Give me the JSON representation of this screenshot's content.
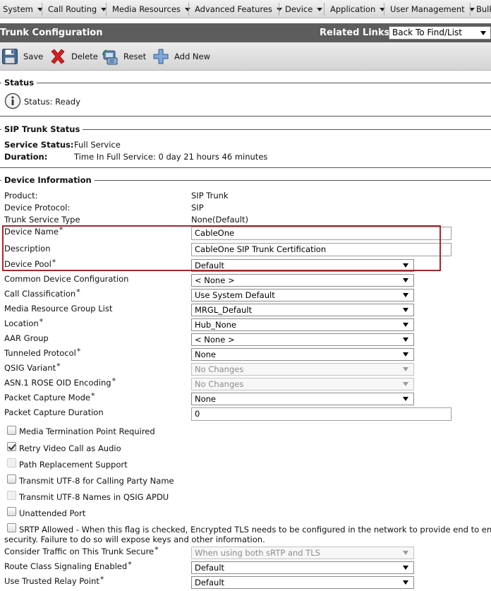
{
  "menu": {
    "items": [
      "System",
      "Call Routing",
      "Media Resources",
      "Advanced Features",
      "Device",
      "Application",
      "User Management",
      "Bulk"
    ]
  },
  "header": {
    "title": "Trunk Configuration",
    "related_links_label": "Related Links:",
    "related_links_value": "Back To Find/List"
  },
  "toolbar": {
    "save": "Save",
    "delete": "Delete",
    "reset": "Reset",
    "add_new": "Add New"
  },
  "status": {
    "section": "Status",
    "text": "Status: Ready"
  },
  "sip_status": {
    "section": "SIP Trunk Status",
    "service_status_label": "Service Status:",
    "service_status_value": "Full Service",
    "duration_label": "Duration:",
    "duration_value": "Time In Full Service: 0 day 21 hours 46 minutes"
  },
  "device_info": {
    "section": "Device Information",
    "product_label": "Product:",
    "product_value": "SIP Trunk",
    "protocol_label": "Device Protocol:",
    "protocol_value": "SIP",
    "service_type_label": "Trunk Service Type",
    "service_type_value": "None(Default)",
    "device_name_label": "Device Name",
    "device_name_value": "CableOne",
    "description_label": "Description",
    "description_value": "CableOne SIP Trunk Certification",
    "device_pool_label": "Device Pool",
    "device_pool_value": "Default",
    "common_config_label": "Common Device Configuration",
    "common_config_value": "< None >",
    "call_class_label": "Call Classification",
    "call_class_value": "Use System Default",
    "mrgl_label": "Media Resource Group List",
    "mrgl_value": "MRGL_Default",
    "location_label": "Location",
    "location_value": "Hub_None",
    "aar_label": "AAR Group",
    "aar_value": "< None >",
    "tunneled_label": "Tunneled Protocol",
    "tunneled_value": "None",
    "qsig_label": "QSIG Variant",
    "qsig_value": "No Changes",
    "asn_label": "ASN.1 ROSE OID Encoding",
    "asn_value": "No Changes",
    "capture_mode_label": "Packet Capture Mode",
    "capture_mode_value": "None",
    "capture_duration_label": "Packet Capture Duration",
    "capture_duration_value": "0",
    "mtp_label": "Media Termination Point Required",
    "retry_label": "Retry Video Call as Audio",
    "path_label": "Path Replacement Support",
    "utf8_calling_label": "Transmit UTF-8 for Calling Party Name",
    "utf8_qsig_label": "Transmit UTF-8 Names in QSIG APDU",
    "unattended_label": "Unattended Port",
    "srtp_label_1": "SRTP Allowed - When this flag is checked, Encrypted TLS needs to be configured in the network to provide end to end",
    "srtp_label_2": "security. Failure to do so will expose keys and other information.",
    "traffic_secure_label": "Consider Traffic on This Trunk Secure",
    "traffic_secure_value": "When using both sRTP and TLS",
    "route_class_label": "Route Class Signaling Enabled",
    "route_class_value": "Default",
    "trusted_relay_label": "Use Trusted Relay Point",
    "trusted_relay_value": "Default"
  },
  "required_marker": "*"
}
